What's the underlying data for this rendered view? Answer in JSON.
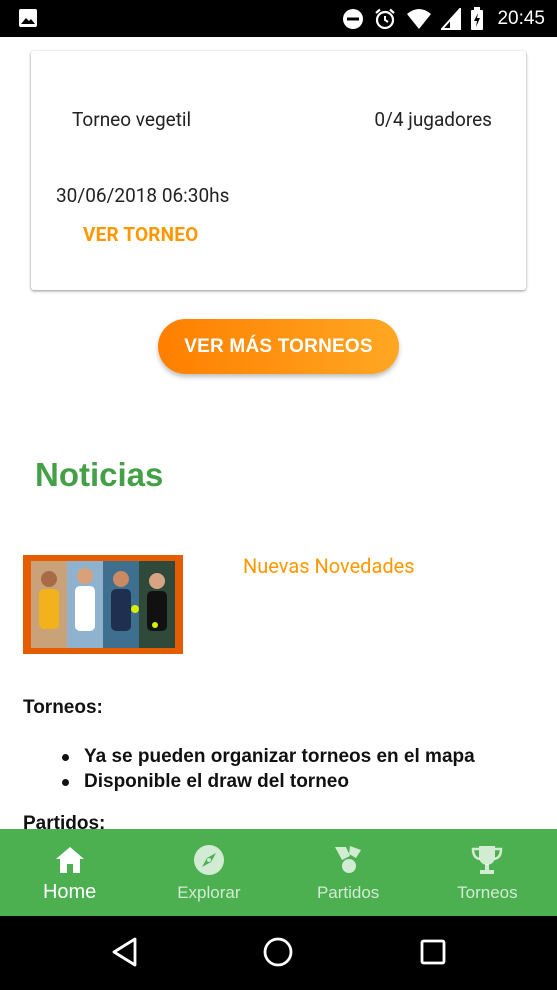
{
  "status_bar": {
    "time": "20:45"
  },
  "tournament_card": {
    "name": "Torneo vegetil",
    "players": "0/4 jugadores",
    "datetime": "30/06/2018 06:30hs",
    "link_label": "VER TORNEO"
  },
  "more_button_label": "VER MÁS TORNEOS",
  "news": {
    "section_title": "Noticias",
    "headline": "Nuevas Novedades",
    "torneos_heading": "Torneos:",
    "torneos_items": [
      "Ya se pueden organizar torneos en el mapa",
      "Disponible el draw del torneo"
    ],
    "partidos_heading": "Partidos:"
  },
  "bottom_nav": [
    {
      "label": "Home",
      "icon": "home-icon",
      "active": true
    },
    {
      "label": "Explorar",
      "icon": "compass-icon",
      "active": false
    },
    {
      "label": "Partidos",
      "icon": "tennis-icon",
      "active": false
    },
    {
      "label": "Torneos",
      "icon": "trophy-icon",
      "active": false
    }
  ],
  "colors": {
    "accent_orange": "#ff9800",
    "nav_green": "#4caf50",
    "title_green": "#43a047"
  }
}
